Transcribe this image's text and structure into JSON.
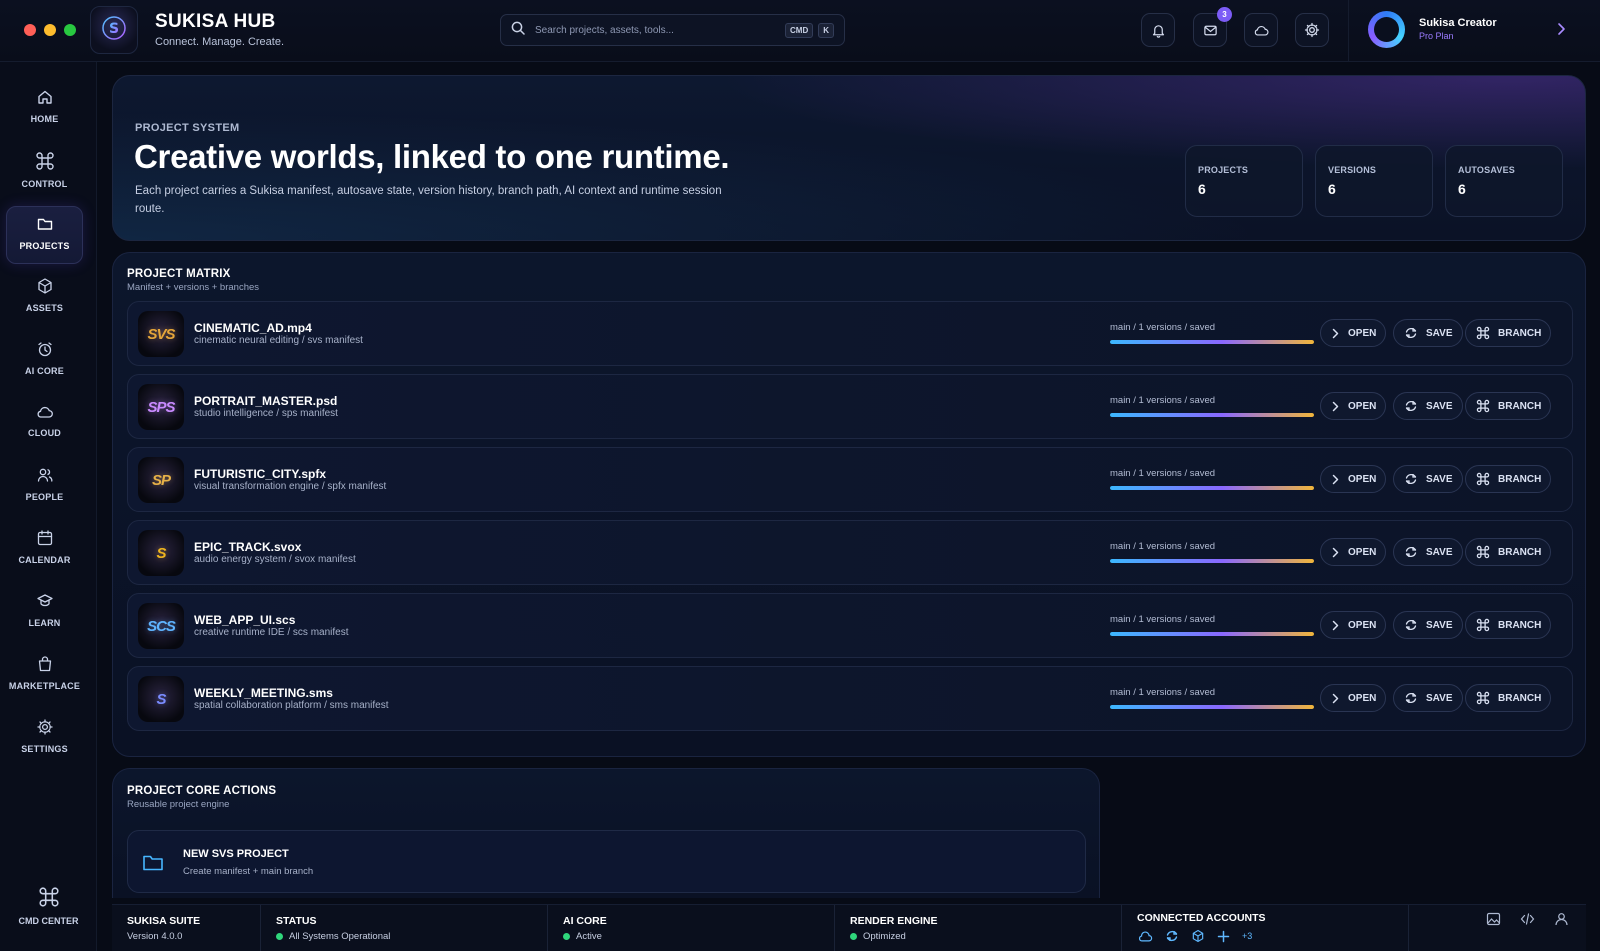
{
  "window": {
    "traffic_lights": [
      "close",
      "minimize",
      "maximize"
    ]
  },
  "brand": {
    "title": "SUKISA HUB",
    "subtitle": "Connect. Manage. Create.",
    "logo_icon": "sukisa-logo"
  },
  "search": {
    "placeholder": "Search projects, assets, tools...",
    "shortcut_mod": "CMD",
    "shortcut_key": "K"
  },
  "top_actions": {
    "notification_badge": "3"
  },
  "user": {
    "name": "Sukisa Creator",
    "plan": "Pro Plan"
  },
  "sidebar": {
    "items": [
      {
        "label": "HOME",
        "icon": "home-icon",
        "active": false
      },
      {
        "label": "CONTROL",
        "icon": "command-icon",
        "active": false
      },
      {
        "label": "PROJECTS",
        "icon": "folder-icon",
        "active": true
      },
      {
        "label": "ASSETS",
        "icon": "cube-icon",
        "active": false
      },
      {
        "label": "AI CORE",
        "icon": "alarm-icon",
        "active": false
      },
      {
        "label": "CLOUD",
        "icon": "cloud-icon",
        "active": false
      },
      {
        "label": "PEOPLE",
        "icon": "people-icon",
        "active": false
      },
      {
        "label": "CALENDAR",
        "icon": "calendar-icon",
        "active": false
      },
      {
        "label": "LEARN",
        "icon": "learn-icon",
        "active": false
      },
      {
        "label": "MARKETPLACE",
        "icon": "bag-icon",
        "active": false
      },
      {
        "label": "SETTINGS",
        "icon": "gear-icon",
        "active": false
      }
    ],
    "bottom": {
      "label": "CMD CENTER",
      "icon": "command-icon"
    }
  },
  "hero": {
    "kicker": "PROJECT SYSTEM",
    "title": "Creative worlds, linked to one runtime.",
    "description": "Each project carries a Sukisa manifest, autosave state, version history, branch path, AI context and runtime session route.",
    "stats": [
      {
        "label": "PROJECTS",
        "value": "6"
      },
      {
        "label": "VERSIONS",
        "value": "6"
      },
      {
        "label": "AUTOSAVES",
        "value": "6"
      }
    ]
  },
  "matrix": {
    "title": "PROJECT MATRIX",
    "subtitle": "Manifest + versions + branches",
    "buttons": {
      "open": "OPEN",
      "save": "SAVE",
      "branch": "BRANCH"
    },
    "rows": [
      {
        "name": "CINEMATIC_AD.mp4",
        "desc": "cinematic neural editing / svs manifest",
        "meta": "main / 1 versions / saved",
        "progress": 1.0,
        "thumb": "SVS",
        "thumb_color": "#e6a63a"
      },
      {
        "name": "PORTRAIT_MASTER.psd",
        "desc": "studio intelligence / sps manifest",
        "meta": "main / 1 versions / saved",
        "progress": 1.0,
        "thumb": "SPS",
        "thumb_color": "#c98bff"
      },
      {
        "name": "FUTURISTIC_CITY.spfx",
        "desc": "visual transformation engine / spfx manifest",
        "meta": "main / 1 versions / saved",
        "progress": 1.0,
        "thumb": "SP",
        "thumb_color": "#e7b148"
      },
      {
        "name": "EPIC_TRACK.svox",
        "desc": "audio energy system / svox manifest",
        "meta": "main / 1 versions / saved",
        "progress": 1.0,
        "thumb": "S",
        "thumb_color": "#f0b51f"
      },
      {
        "name": "WEB_APP_UI.scs",
        "desc": "creative runtime IDE / scs manifest",
        "meta": "main / 1 versions / saved",
        "progress": 1.0,
        "thumb": "SCS",
        "thumb_color": "#5fb4ff"
      },
      {
        "name": "WEEKLY_MEETING.sms",
        "desc": "spatial collaboration platform / sms manifest",
        "meta": "main / 1 versions / saved",
        "progress": 1.0,
        "thumb": "S",
        "thumb_color": "#7a8cff"
      }
    ]
  },
  "core_actions": {
    "title": "PROJECT CORE ACTIONS",
    "subtitle": "Reusable project engine",
    "items": [
      {
        "name": "NEW SVS PROJECT",
        "desc": "Create manifest + main branch",
        "icon": "folder-icon"
      }
    ]
  },
  "statusbar": {
    "suite": {
      "label": "SUKISA SUITE",
      "value": "Version 4.0.0"
    },
    "status": {
      "label": "STATUS",
      "value": "All Systems Operational"
    },
    "ai_core": {
      "label": "AI CORE",
      "value": "Active"
    },
    "render": {
      "label": "RENDER ENGINE",
      "value": "Optimized"
    },
    "accounts": {
      "label": "CONNECTED ACCOUNTS",
      "more": "+3"
    }
  },
  "colors": {
    "accent": "#7c5cf6",
    "success": "#2fd67b",
    "bg": "#070b16"
  }
}
